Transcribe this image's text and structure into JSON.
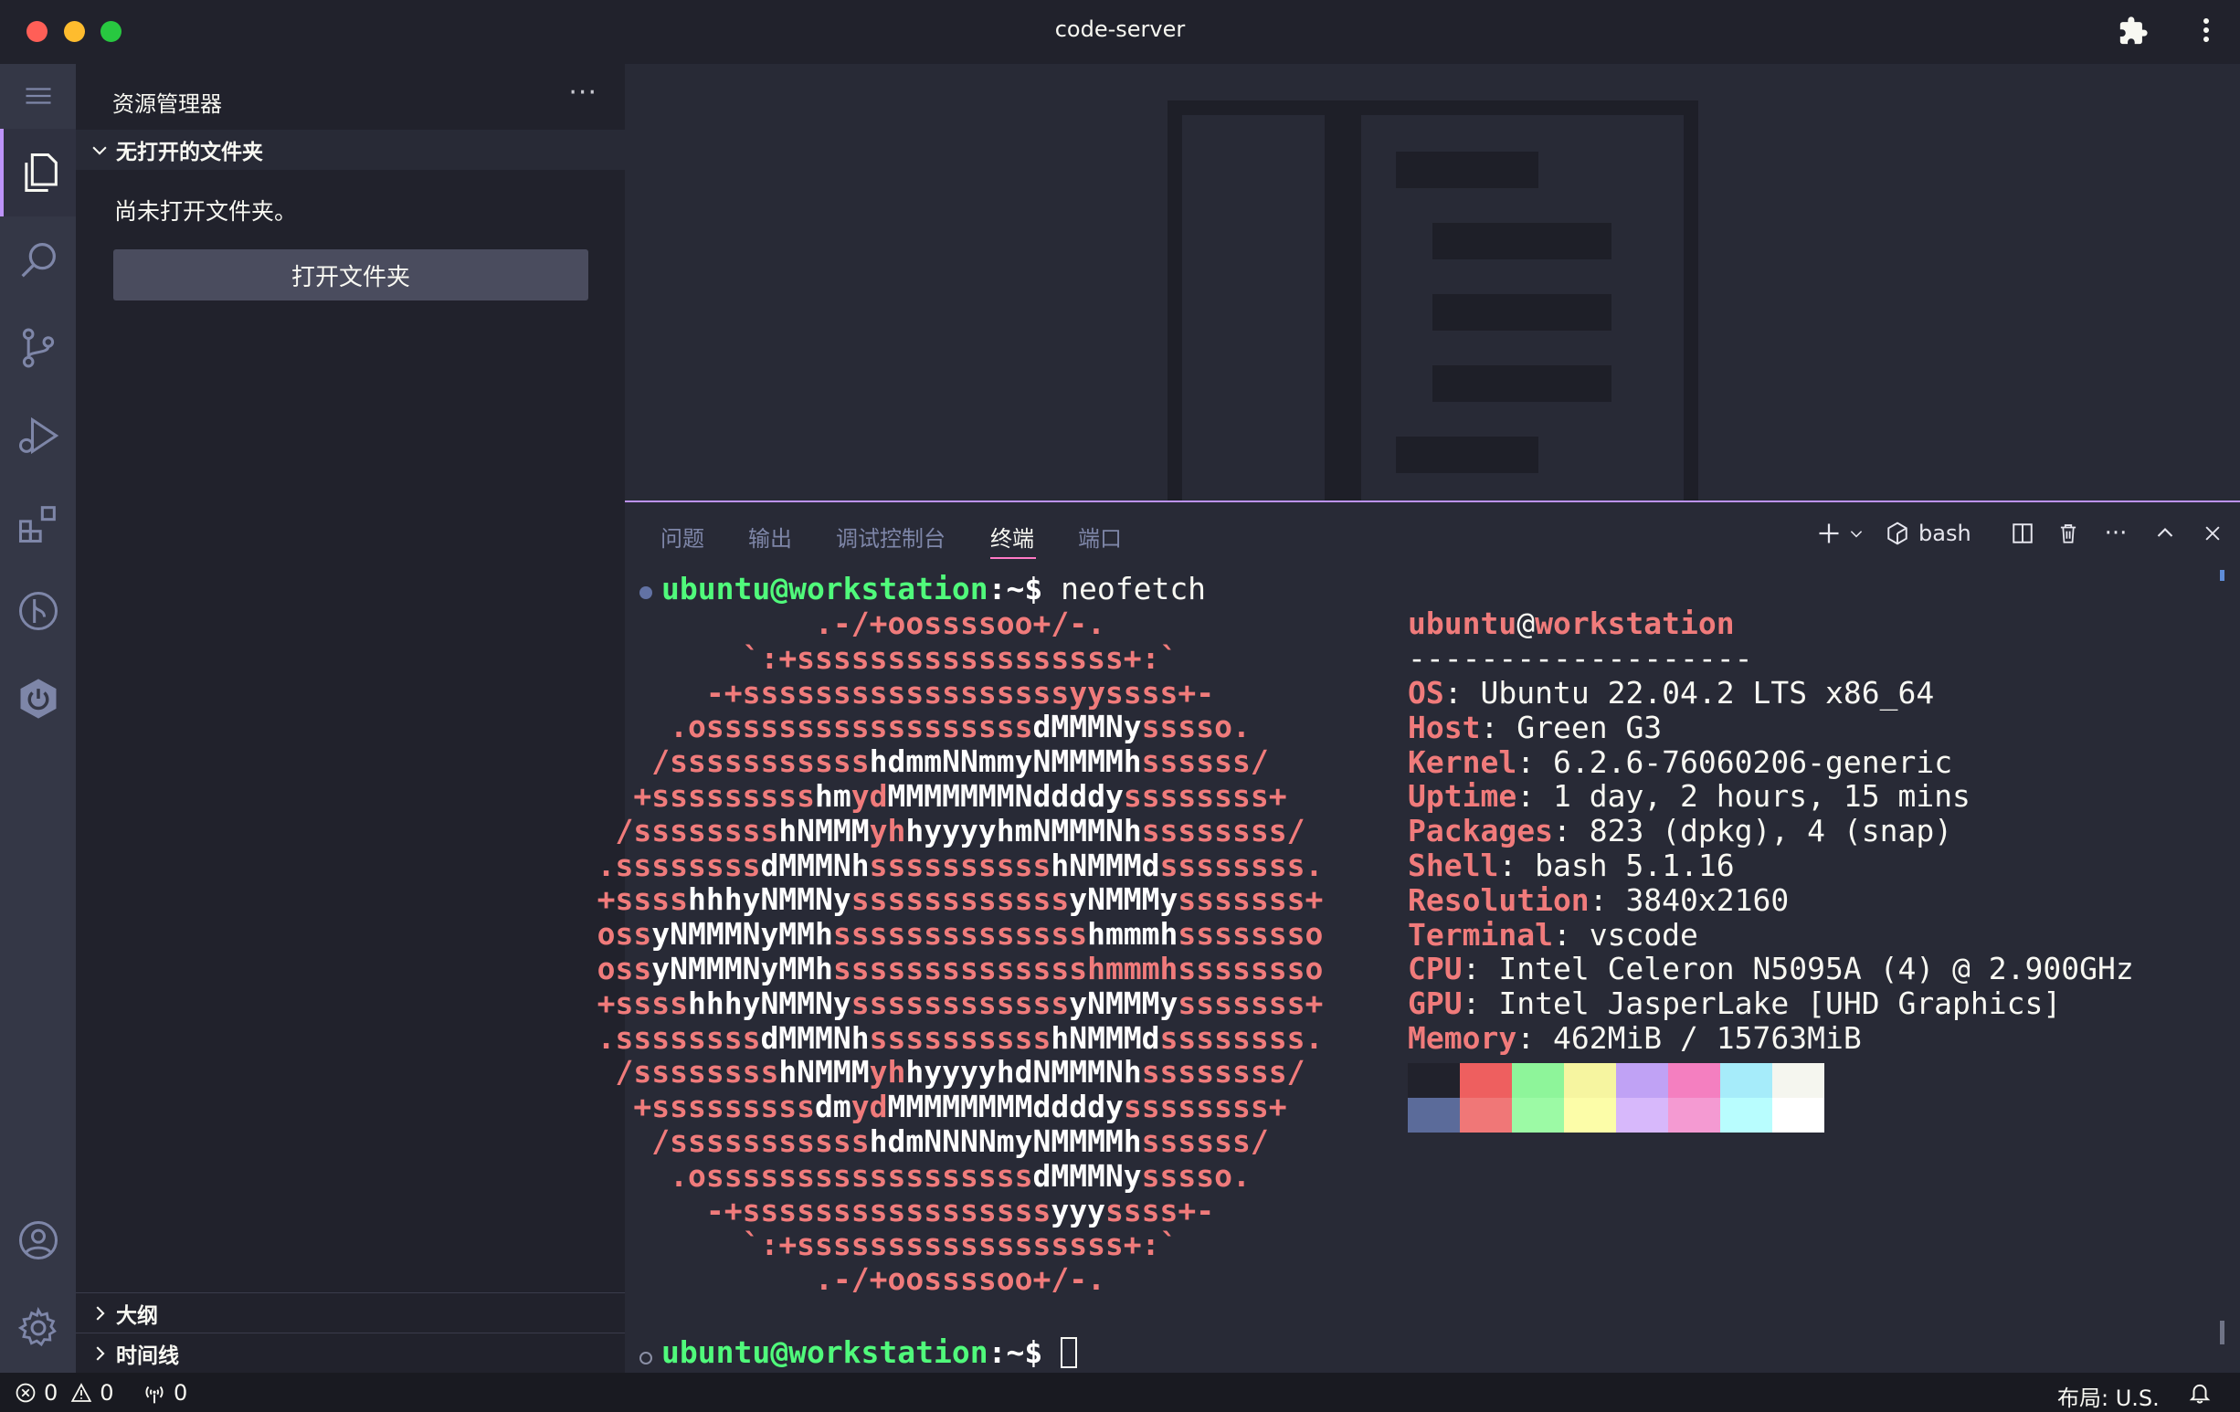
{
  "window": {
    "title": "code-server"
  },
  "sidebar": {
    "title": "资源管理器",
    "more_label": "···",
    "section_label": "无打开的文件夹",
    "empty_text": "尚未打开文件夹。",
    "open_button": "打开文件夹",
    "outline_label": "大纲",
    "timeline_label": "时间线"
  },
  "panel": {
    "tabs": [
      "问题",
      "输出",
      "调试控制台",
      "终端",
      "端口"
    ],
    "active_tab": "终端",
    "terminal_name": "bash",
    "more_label": "···"
  },
  "terminal": {
    "prompt_user": "ubuntu@workstation",
    "prompt_path": ":~$",
    "command": "neofetch",
    "logo": [
      [
        [
          "r",
          "         .-/+oossssoo+/-.          "
        ]
      ],
      [
        [
          "r",
          "     `:+ssssssssssssssssss+:`      "
        ]
      ],
      [
        [
          "r",
          "   -+ssssssssssssssssssyyssss+-    "
        ]
      ],
      [
        [
          "r",
          " .ossssssssssssssssss"
        ],
        [
          "w",
          "dMMMNy"
        ],
        [
          "r",
          "sssso.  "
        ]
      ],
      [
        [
          "r",
          "/sssssssssss"
        ],
        [
          "w",
          "hdmmNNmmyNMMMMh"
        ],
        [
          "r",
          "ssssss/ "
        ]
      ],
      [
        [
          "r",
          "+sssssssss"
        ],
        [
          "w",
          "hm"
        ],
        [
          "r",
          "yd"
        ],
        [
          "w",
          "MMMMMMMNddddy"
        ],
        [
          "r",
          "ssssssss+"
        ]
      ],
      [
        [
          "r",
          "/ssssssss"
        ],
        [
          "w",
          "hNMMM"
        ],
        [
          "r",
          "yh"
        ],
        [
          "w",
          "hyyyyhmNMMMNh"
        ],
        [
          "r",
          "ssssssss/"
        ]
      ],
      [
        [
          "r",
          ".ssssssss"
        ],
        [
          "w",
          "dMMMNh"
        ],
        [
          "r",
          "ssssssssss"
        ],
        [
          "w",
          "hNMMMd"
        ],
        [
          "r",
          "ssssssss."
        ]
      ],
      [
        [
          "r",
          "+ssss"
        ],
        [
          "w",
          "hhhyNMMNy"
        ],
        [
          "r",
          "ssssssssssss"
        ],
        [
          "w",
          "yNMMMy"
        ],
        [
          "r",
          "sssssss+"
        ]
      ],
      [
        [
          "r",
          "oss"
        ],
        [
          "w",
          "yNMMMNyMMh"
        ],
        [
          "r",
          "ssssssssssssss"
        ],
        [
          "w",
          "hmmmh"
        ],
        [
          "r",
          "ssssssso"
        ]
      ],
      [
        [
          "r",
          "oss"
        ],
        [
          "w",
          "yNMMMNyMMh"
        ],
        [
          "r",
          "sssssssssssssshmmmhssssssso"
        ]
      ],
      [
        [
          "r",
          "+ssss"
        ],
        [
          "w",
          "hhhyNMMNy"
        ],
        [
          "r",
          "ssssssssssss"
        ],
        [
          "w",
          "yNMMMy"
        ],
        [
          "r",
          "sssssss+"
        ]
      ],
      [
        [
          "r",
          ".ssssssss"
        ],
        [
          "w",
          "dMMMNh"
        ],
        [
          "r",
          "ssssssssss"
        ],
        [
          "w",
          "hNMMMd"
        ],
        [
          "r",
          "ssssssss."
        ]
      ],
      [
        [
          "r",
          "/ssssssss"
        ],
        [
          "w",
          "hNMMM"
        ],
        [
          "r",
          "yh"
        ],
        [
          "w",
          "hyyyyhdNMMMNh"
        ],
        [
          "r",
          "ssssssss/"
        ]
      ],
      [
        [
          "r",
          "+sssssssss"
        ],
        [
          "w",
          "dm"
        ],
        [
          "r",
          "yd"
        ],
        [
          "w",
          "MMMMMMMMddddy"
        ],
        [
          "r",
          "ssssssss+"
        ]
      ],
      [
        [
          "r",
          "/sssssssssss"
        ],
        [
          "w",
          "hdmNNNNmyNMMMMh"
        ],
        [
          "r",
          "ssssss/ "
        ]
      ],
      [
        [
          "r",
          " .ossssssssssssssssss"
        ],
        [
          "w",
          "dMMMNy"
        ],
        [
          "r",
          "sssso.  "
        ]
      ],
      [
        [
          "r",
          "   -+sssssssssssssssss"
        ],
        [
          "w",
          "yyy"
        ],
        [
          "r",
          "ssss+-    "
        ]
      ],
      [
        [
          "r",
          "     `:+ssssssssssssssssss+:`      "
        ]
      ],
      [
        [
          "r",
          "         .-/+oossssoo+/-.          "
        ]
      ]
    ],
    "info_user": "ubuntu",
    "info_at": "@",
    "info_host": "workstation",
    "separator": "-------------------",
    "info": [
      {
        "label": "OS",
        "value": "Ubuntu 22.04.2 LTS x86_64"
      },
      {
        "label": "Host",
        "value": "Green G3"
      },
      {
        "label": "Kernel",
        "value": "6.2.6-76060206-generic"
      },
      {
        "label": "Uptime",
        "value": "1 day, 2 hours, 15 mins"
      },
      {
        "label": "Packages",
        "value": "823 (dpkg), 4 (snap)"
      },
      {
        "label": "Shell",
        "value": "bash 5.1.16"
      },
      {
        "label": "Resolution",
        "value": "3840x2160"
      },
      {
        "label": "Terminal",
        "value": "vscode"
      },
      {
        "label": "CPU",
        "value": "Intel Celeron N5095A (4) @ 2.900GHz"
      },
      {
        "label": "GPU",
        "value": "Intel JasperLake [UHD Graphics]"
      },
      {
        "label": "Memory",
        "value": "462MiB / 15763MiB"
      }
    ],
    "palette_top": [
      "#21222c",
      "#ee5f5f",
      "#8ef59a",
      "#f6f5a0",
      "#c0a2f5",
      "#f47fc0",
      "#a6ecfa",
      "#f5f6ef"
    ],
    "palette_bottom": [
      "#5b6b9a",
      "#f07777",
      "#9cfaa5",
      "#fcfda8",
      "#d7b8fb",
      "#f49ad2",
      "#b8fdfe",
      "#ffffff"
    ]
  },
  "statusbar": {
    "errors": "0",
    "warnings": "0",
    "ports": "0",
    "layout": "布局: U.S."
  },
  "colors": {
    "accent": "#bd93f9",
    "tab_underline": "#ff79c6",
    "prompt_green": "#50fa7b",
    "label_red": "#f07b7b"
  }
}
